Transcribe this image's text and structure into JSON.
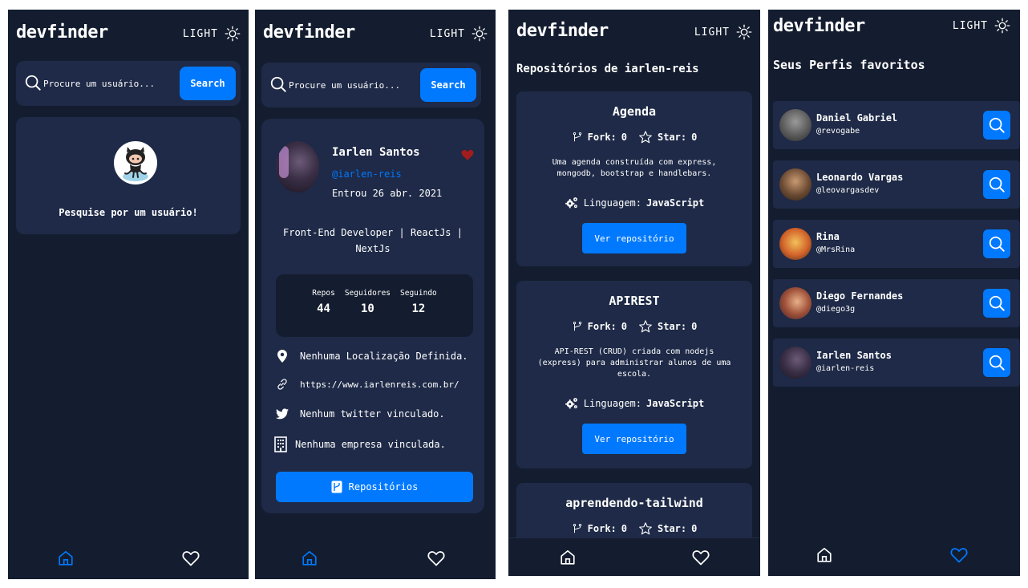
{
  "app": {
    "logo": "devfinder",
    "theme_label": "LIGHT"
  },
  "colors": {
    "background": "#141d2f",
    "card": "#1e2a47",
    "accent": "#0079ff",
    "favorite": "#a11d1d"
  },
  "search": {
    "placeholder": "Procure um usuário...",
    "button": "Search"
  },
  "screen1": {
    "empty_message": "Pesquise por um usuário!"
  },
  "profile": {
    "name": "Iarlen Santos",
    "login": "@iarlen-reis",
    "joined": "Entrou 26 abr. 2021",
    "bio": "Front-End Developer | ReactJs | NextJs",
    "stats": [
      {
        "label": "Repos",
        "value": "44"
      },
      {
        "label": "Seguidores",
        "value": "10"
      },
      {
        "label": "Seguindo",
        "value": "12"
      }
    ],
    "location": "Nenhuma Localização Definida.",
    "blog": "https://www.iarlenreis.com.br/",
    "twitter": "Nenhum twitter vinculado.",
    "company": "Nenhuma empresa vinculada.",
    "repos_button": "Repositórios"
  },
  "repositories": {
    "title": "Repositórios de iarlen-reis",
    "fork_label": "Fork:",
    "star_label": "Star:",
    "language_label": "Linguagem:",
    "view_button": "Ver repositório",
    "items": [
      {
        "name": "Agenda",
        "forks": "0",
        "stars": "0",
        "description": "Uma agenda construída com express, mongodb, bootstrap  e  handlebars.",
        "language": "JavaScript"
      },
      {
        "name": "APIREST",
        "forks": "0",
        "stars": "0",
        "description": "API-REST (CRUD) criada com nodejs (express) para administrar alunos de uma escola.",
        "language": "JavaScript"
      },
      {
        "name": "aprendendo-tailwind",
        "forks": "0",
        "stars": "0"
      }
    ]
  },
  "favorites": {
    "title": "Seus Perfis favoritos",
    "items": [
      {
        "name": "Daniel Gabriel",
        "login": "@revogabe"
      },
      {
        "name": "Leonardo Vargas",
        "login": "@leovargasdev"
      },
      {
        "name": "Rina",
        "login": "@MrsRina"
      },
      {
        "name": "Diego Fernandes",
        "login": "@diego3g"
      },
      {
        "name": "Iarlen Santos",
        "login": "@iarlen-reis"
      }
    ]
  },
  "icons": {
    "sun": "sun-icon",
    "search": "search-icon",
    "home": "home-icon",
    "heart": "heart-icon",
    "location": "location-pin-icon",
    "link": "link-icon",
    "twitter": "twitter-icon",
    "company": "building-icon",
    "fork": "fork-icon",
    "star": "star-icon",
    "gears": "gears-icon"
  }
}
